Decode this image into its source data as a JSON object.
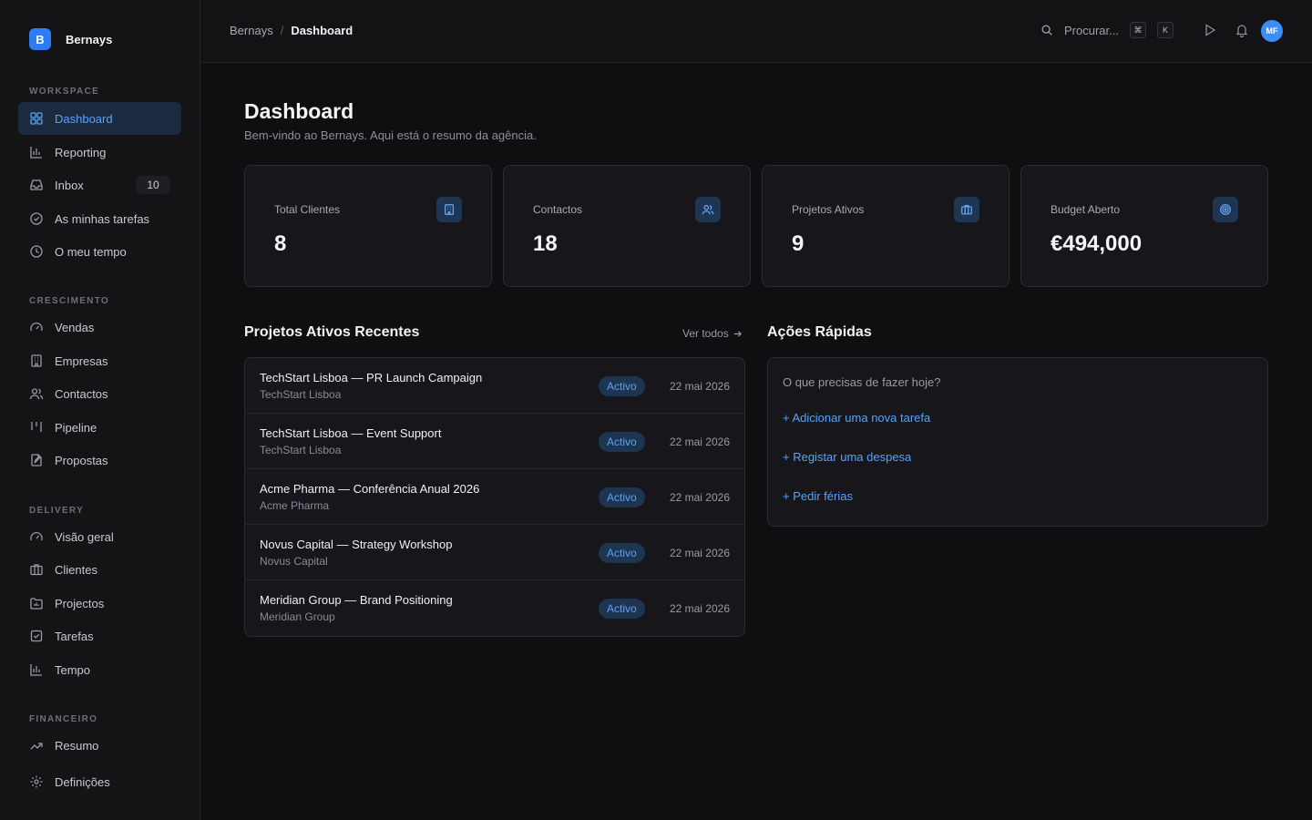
{
  "brand": {
    "logo_letter": "B",
    "name": "Bernays"
  },
  "sidebar": {
    "sections": [
      {
        "label": "WORKSPACE"
      },
      {
        "label": "CRESCIMENTO"
      },
      {
        "label": "DELIVERY"
      },
      {
        "label": "FINANCEIRO"
      }
    ],
    "items": [
      {
        "label": "Dashboard",
        "icon": "grid-icon",
        "active": true
      },
      {
        "label": "Reporting",
        "icon": "bar-chart-icon"
      },
      {
        "label": "Inbox",
        "icon": "inbox-icon",
        "badge": "10"
      },
      {
        "label": "As minhas tarefas",
        "icon": "check-circle-icon"
      },
      {
        "label": "O meu tempo",
        "icon": "clock-icon"
      },
      {
        "label": "Vendas",
        "icon": "gauge-icon"
      },
      {
        "label": "Empresas",
        "icon": "building-icon"
      },
      {
        "label": "Contactos",
        "icon": "users-icon"
      },
      {
        "label": "Pipeline",
        "icon": "pipeline-icon"
      },
      {
        "label": "Propostas",
        "icon": "document-edit-icon"
      },
      {
        "label": "Visão geral",
        "icon": "gauge-icon"
      },
      {
        "label": "Clientes",
        "icon": "briefcase-icon"
      },
      {
        "label": "Projectos",
        "icon": "folder-chart-icon"
      },
      {
        "label": "Tarefas",
        "icon": "checkbox-icon"
      },
      {
        "label": "Tempo",
        "icon": "bar-chart-icon"
      },
      {
        "label": "Resumo",
        "icon": "trending-up-icon"
      },
      {
        "label": "Definições",
        "icon": "gear-icon"
      }
    ]
  },
  "topbar": {
    "breadcrumb_parent": "Bernays",
    "breadcrumb_sep": "/",
    "breadcrumb_current": "Dashboard",
    "search_placeholder": "Procurar...",
    "kbd_mod": "⌘",
    "kbd_key": "K",
    "avatar_initials": "MF"
  },
  "page": {
    "title": "Dashboard",
    "subtitle": "Bem-vindo ao Bernays. Aqui está o resumo da agência."
  },
  "stats": [
    {
      "label": "Total Clientes",
      "value": "8",
      "icon": "building-icon"
    },
    {
      "label": "Contactos",
      "value": "18",
      "icon": "users-icon"
    },
    {
      "label": "Projetos Ativos",
      "value": "9",
      "icon": "briefcase-icon"
    },
    {
      "label": "Budget Aberto",
      "value": "€494,000",
      "icon": "target-icon"
    }
  ],
  "projects": {
    "title": "Projetos Ativos Recentes",
    "see_all": "Ver todos",
    "rows": [
      {
        "name": "TechStart Lisboa — PR Launch Campaign",
        "client": "TechStart Lisboa",
        "status": "Activo",
        "date": "22 mai 2026"
      },
      {
        "name": "TechStart Lisboa — Event Support",
        "client": "TechStart Lisboa",
        "status": "Activo",
        "date": "22 mai 2026"
      },
      {
        "name": "Acme Pharma — Conferência Anual 2026",
        "client": "Acme Pharma",
        "status": "Activo",
        "date": "22 mai 2026"
      },
      {
        "name": "Novus Capital — Strategy Workshop",
        "client": "Novus Capital",
        "status": "Activo",
        "date": "22 mai 2026"
      },
      {
        "name": "Meridian Group — Brand Positioning",
        "client": "Meridian Group",
        "status": "Activo",
        "date": "22 mai 2026"
      }
    ]
  },
  "quick_actions": {
    "title": "Ações Rápidas",
    "prompt": "O que precisas de fazer hoje?",
    "links": [
      "+ Adicionar uma nova tarefa",
      "+ Registar uma despesa",
      "+ Pedir férias"
    ]
  },
  "colors": {
    "accent": "#5aa2f7",
    "brand": "#2f7bf5",
    "background": "#0f0f12"
  }
}
